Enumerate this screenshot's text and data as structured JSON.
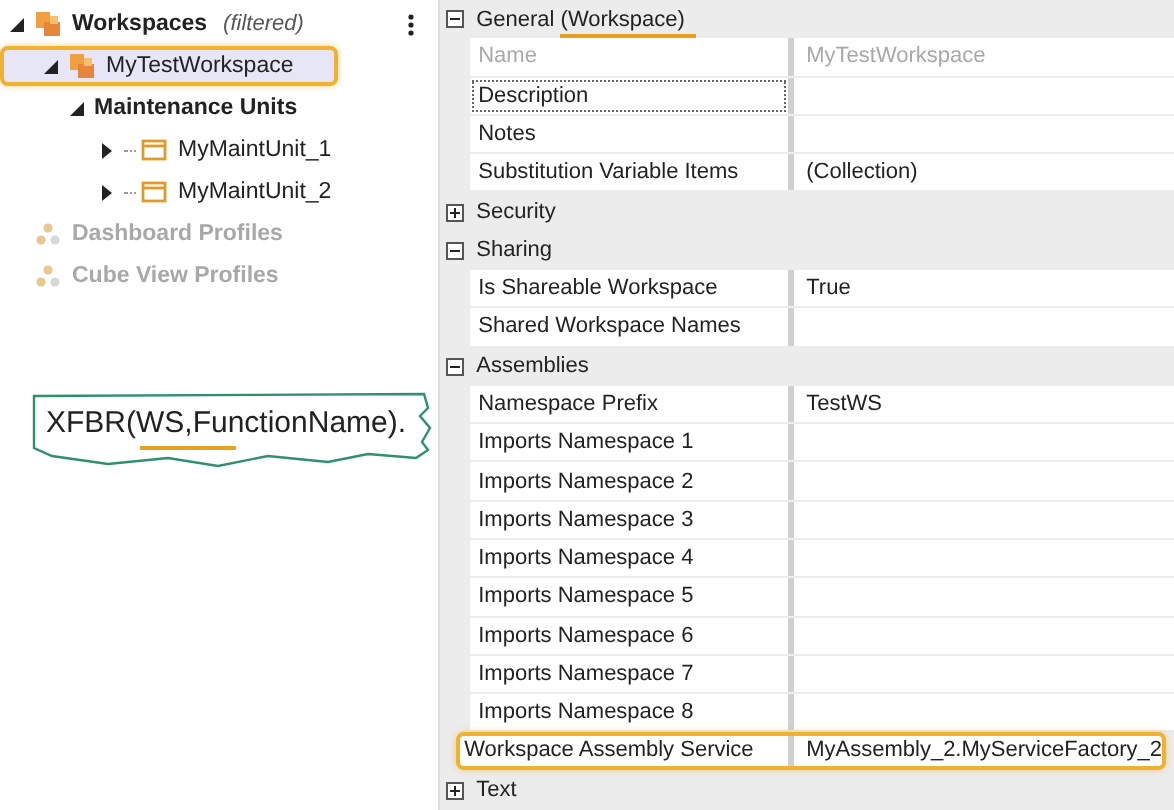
{
  "tree": {
    "items": [
      {
        "label": "Workspaces",
        "note": "(filtered)",
        "kind": "root",
        "expanded": true,
        "disabled": false,
        "selected": false,
        "children": [
          {
            "label": "MyTestWorkspace",
            "kind": "workspace",
            "expanded": true,
            "disabled": false,
            "selected": true,
            "children": [
              {
                "label": "Maintenance Units",
                "kind": "group",
                "expanded": true,
                "disabled": false,
                "selected": false,
                "children": [
                  {
                    "label": "MyMaintUnit_1",
                    "kind": "unit",
                    "expanded": false,
                    "disabled": false,
                    "selected": false
                  },
                  {
                    "label": "MyMaintUnit_2",
                    "kind": "unit",
                    "expanded": false,
                    "disabled": false,
                    "selected": false
                  }
                ]
              }
            ]
          }
        ]
      },
      {
        "label": "Dashboard Profiles",
        "kind": "profile",
        "disabled": true,
        "selected": false
      },
      {
        "label": "Cube View Profiles",
        "kind": "profile",
        "disabled": true,
        "selected": false
      }
    ]
  },
  "callout": {
    "text": "XFBR(WS,FunctionName).",
    "underlined": true
  },
  "properties": {
    "categories": [
      {
        "label": "General (Workspace)",
        "expanded": true,
        "underlined": true,
        "rows": [
          {
            "name": "Name",
            "value": "MyTestWorkspace",
            "disabled": true,
            "focused": false,
            "highlighted": false
          },
          {
            "name": "Description",
            "disabled": false,
            "focused": true,
            "highlighted": false
          },
          {
            "name": "Notes",
            "disabled": false,
            "focused": false,
            "highlighted": false
          },
          {
            "name": "Substitution Variable Items",
            "value": "(Collection)",
            "disabled": false,
            "focused": false,
            "highlighted": false
          }
        ]
      },
      {
        "label": "Security",
        "expanded": false,
        "underlined": false
      },
      {
        "label": "Sharing",
        "expanded": true,
        "underlined": false,
        "rows": [
          {
            "name": "Is Shareable Workspace",
            "value": "True",
            "disabled": false,
            "focused": false,
            "highlighted": false
          },
          {
            "name": "Shared Workspace Names",
            "disabled": false,
            "focused": false,
            "highlighted": false
          }
        ]
      },
      {
        "label": "Assemblies",
        "expanded": true,
        "underlined": false,
        "rows": [
          {
            "name": "Namespace Prefix",
            "value": "TestWS",
            "disabled": false,
            "focused": false,
            "highlighted": false
          },
          {
            "name": "Imports Namespace 1",
            "disabled": false,
            "focused": false,
            "highlighted": false
          },
          {
            "name": "Imports Namespace 2",
            "disabled": false,
            "focused": false,
            "highlighted": false
          },
          {
            "name": "Imports Namespace 3",
            "disabled": false,
            "focused": false,
            "highlighted": false
          },
          {
            "name": "Imports Namespace 4",
            "disabled": false,
            "focused": false,
            "highlighted": false
          },
          {
            "name": "Imports Namespace 5",
            "disabled": false,
            "focused": false,
            "highlighted": false
          },
          {
            "name": "Imports Namespace 6",
            "disabled": false,
            "focused": false,
            "highlighted": false
          },
          {
            "name": "Imports Namespace 7",
            "disabled": false,
            "focused": false,
            "highlighted": false
          },
          {
            "name": "Imports Namespace 8",
            "disabled": false,
            "focused": false,
            "highlighted": false
          },
          {
            "name": "Workspace Assembly Service",
            "value": "MyAssembly_2.MyServiceFactory_2",
            "disabled": false,
            "focused": false,
            "highlighted": true
          }
        ]
      },
      {
        "label": "Text",
        "expanded": false,
        "underlined": false
      }
    ]
  }
}
